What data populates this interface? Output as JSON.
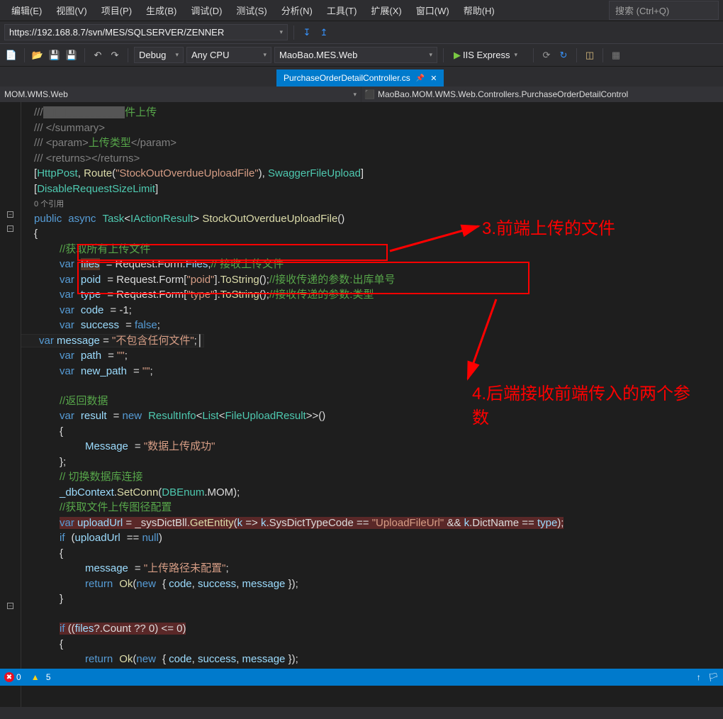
{
  "menu": {
    "items": [
      "编辑(E)",
      "视图(V)",
      "项目(P)",
      "生成(B)",
      "调试(D)",
      "测试(S)",
      "分析(N)",
      "工具(T)",
      "扩展(X)",
      "窗口(W)",
      "帮助(H)"
    ],
    "search_placeholder": "搜索 (Ctrl+Q)"
  },
  "toolbar1": {
    "url": "https://192.168.8.7/svn/MES/SQLSERVER/ZENNER"
  },
  "toolbar2": {
    "config": "Debug",
    "platform": "Any CPU",
    "startup": "MaoBao.MES.Web",
    "run": "IIS Express"
  },
  "tab": {
    "title": "PurchaseOrderDetailController.cs"
  },
  "nav": {
    "left": "MOM.WMS.Web",
    "right": "MaoBao.MOM.WMS.Web.Controllers.PurchaseOrderDetailControl"
  },
  "code": {
    "c1": "///",
    "c2a": "件上传",
    "c3": "/// </summary>",
    "c4": "/// <param>上传类型</param>",
    "c5": "/// <returns></returns>",
    "attr1": "[HttpPost, Route(\"StockOutOverdueUploadFile\"), SwaggerFileUpload]",
    "attr2": "[DisableRequestSizeLimit]",
    "ref": "0 个引用",
    "sig": "public async Task<IActionResult> StockOutOverdueUploadFile()",
    "cmt_getfiles": "//获取所有上传文件",
    "l_files": "var files = Request.Form.Files;",
    "l_files_c": "// 接收上传文件",
    "l_poid": "var poid = Request.Form[\"poid\"].ToString();",
    "l_poid_c": "//接收传递的参数:出库单号",
    "l_type": "var type = Request.Form[\"type\"].ToString();",
    "l_type_c": "//接收传递的参数:类型",
    "l_code": "var code = -1;",
    "l_succ": "var success = false;",
    "l_msg": "var message = \"不包含任何文件\";",
    "l_path": "var path = \"\";",
    "l_np": "var new_path = \"\";",
    "cmt_ret": "//返回数据",
    "l_res": "var result = new ResultInfo<List<FileUploadResult>>()",
    "l_res_msg": "Message = \"数据上传成功\"",
    "cmt_db": "// 切换数据库连接",
    "l_db": "_dbContext.SetConn(DBEnum.MOM);",
    "cmt_url": "//获取文件上传图径配置",
    "l_url": "var uploadUrl = _sysDictBll.GetEntity(k => k.SysDictTypeCode == \"UploadFileUrl\" && k.DictName == type);",
    "l_if1": "if (uploadUrl == null)",
    "l_msg2": "message = \"上传路径未配置\";",
    "l_ret1": "return Ok(new { code, success, message });",
    "l_if2": "if ((files?.Count ?? 0) <= 0)",
    "l_ret2": "return Ok(new { code, success, message });"
  },
  "annotations": {
    "a1": "3.前端上传的文件",
    "a2": "4.后端接收前端传入的两个参数"
  },
  "status": {
    "errors": "0",
    "warnings": "5"
  }
}
